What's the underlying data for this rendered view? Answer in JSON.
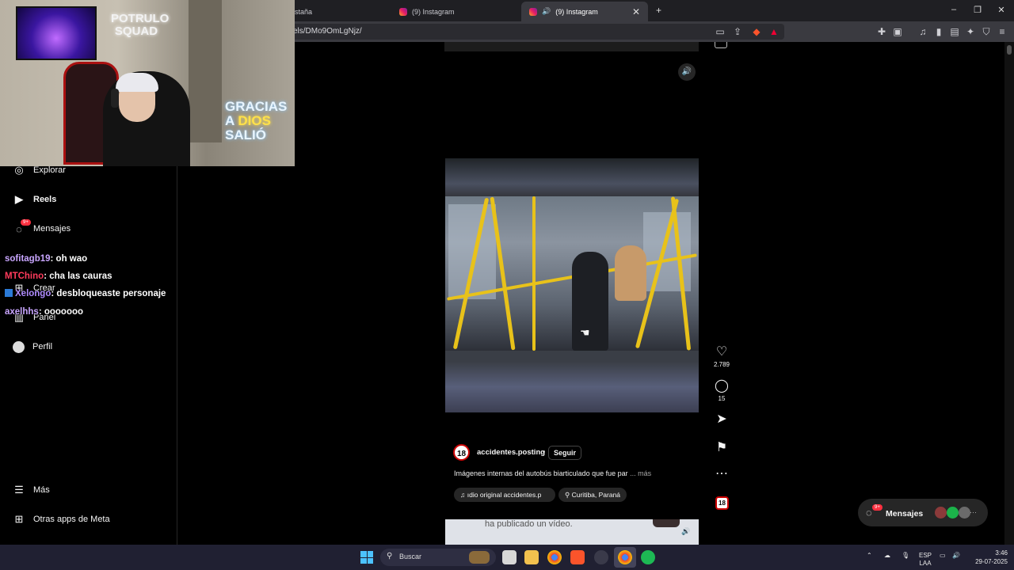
{
  "browser": {
    "tabs": [
      {
        "label": "staña",
        "active": false
      },
      {
        "label": "(9) Instagram",
        "active": false
      },
      {
        "label": "(9) Instagram",
        "active": true
      }
    ],
    "url": "els/DMo9OmLgNjz/",
    "window_controls": [
      "–",
      "❐",
      "✕"
    ]
  },
  "webcam": {
    "sign_top": "POTRULO SQUAD",
    "sign_bottom_line1": "GRACIAS",
    "sign_bottom_a": "A",
    "sign_bottom_dios": "DIOS",
    "sign_bottom_line3": "SALIÓ"
  },
  "nav": {
    "items": [
      {
        "label": "Explorar",
        "icon": "compass-icon"
      },
      {
        "label": "Reels",
        "icon": "reels-icon"
      },
      {
        "label": "Mensajes",
        "icon": "messenger-icon",
        "badge": "9+"
      },
      {
        "label": "Crear",
        "icon": "plus-icon"
      },
      {
        "label": "Panel",
        "icon": "dashboard-icon"
      },
      {
        "label": "Perfil",
        "icon": "avatar-icon"
      },
      {
        "label": "Más",
        "icon": "menu-icon"
      },
      {
        "label": "Otras apps de Meta",
        "icon": "meta-apps-icon"
      }
    ]
  },
  "chat": [
    {
      "user": "sofitagb19",
      "message": ": oh wao",
      "color": "#c9a6ff"
    },
    {
      "user": "MTChino",
      "message": ": cha las cauras",
      "color": "#ff3b5c"
    },
    {
      "user": "Xelongo",
      "message": ": desbloqueaste personaje",
      "color": "#b08cff"
    },
    {
      "user": "axelhhs",
      "message": ": ooooooo",
      "color": "#c9a6ff"
    }
  ],
  "reel": {
    "likes": "2.789",
    "comments": "15",
    "username": "accidentes.posting",
    "follow": "Seguir",
    "separator": "•",
    "caption": "Imágenes internas del autobús biarticulado que fue par",
    "caption_more": "... más",
    "audio": "ıdio original  accidentes.p",
    "location": "Curitiba, Paraná",
    "avatar_text": "18",
    "next_reel_text": "ha publicado un vídeo."
  },
  "messages_pill": {
    "label": "Mensajes",
    "badge": "9+"
  },
  "taskbar": {
    "search": "Buscar",
    "lang_line1": "ESP",
    "lang_line2": "LAA",
    "time": "3:46",
    "date": "29-07-2025"
  },
  "colors": {
    "accent_red": "#ff3040",
    "bg": "#000000",
    "bar_yellow": "#e8c21a"
  }
}
